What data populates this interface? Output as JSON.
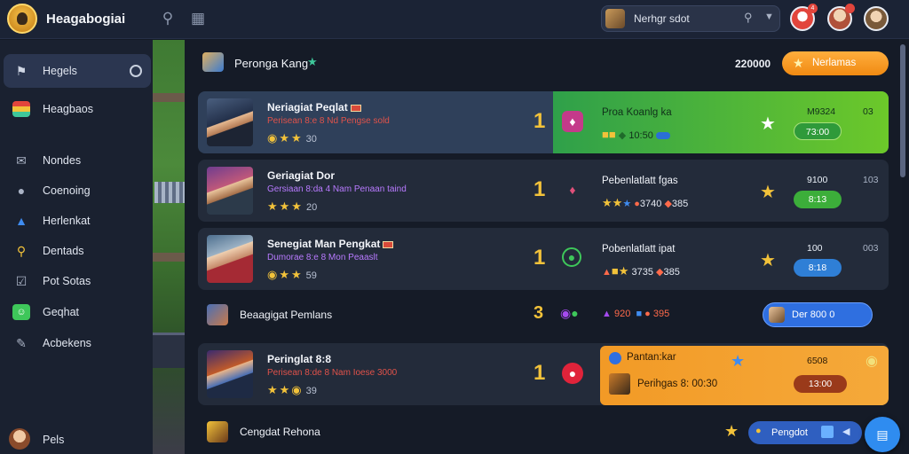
{
  "app": {
    "title": "Heagabogiai"
  },
  "topbar": {
    "search_text": "Nerhgr sdot",
    "notification_badge": "4"
  },
  "sidebar": {
    "items": [
      {
        "label": "Hegels",
        "icon": "flag-icon"
      },
      {
        "label": "Heagbaos",
        "icon": "book-icon"
      },
      {
        "label": "Nondes",
        "icon": "mail-icon"
      },
      {
        "label": "Coenoing",
        "icon": "chat-icon"
      },
      {
        "label": "Herlenkat",
        "icon": "person-icon"
      },
      {
        "label": "Dentads",
        "icon": "key-icon"
      },
      {
        "label": "Pot Sotas",
        "icon": "checkbox-icon"
      },
      {
        "label": "Geqhat",
        "icon": "message-icon"
      },
      {
        "label": "Acbekens",
        "icon": "edit-icon"
      }
    ],
    "user_label": "Pels"
  },
  "header": {
    "title": "Peronga Kang",
    "score": "220000",
    "button_label": "Nerlamas"
  },
  "rows": [
    {
      "name": "Neriagiat Peqlat",
      "sub": "Perisean 8:e 8 Nd Pengse sold",
      "rating": "30",
      "rank": "1",
      "title2": "Proa Koanlg ka",
      "stats": "10:50",
      "val": "M9324",
      "pill": "73:00",
      "val2": "03"
    },
    {
      "name": "Geriagiat Dor",
      "sub": "Gersiaan 8:da 4 Nam Penaan taind",
      "rating": "20",
      "rank": "1",
      "title2": "Pebenlatlatt fgas",
      "stats_a": "3740",
      "stats_b": "385",
      "val": "9100",
      "pill": "8:13",
      "val2": "103"
    },
    {
      "name": "Senegiat Man Pengkat",
      "sub": "Dumorae 8:e 8 Mon Peaaslt",
      "rating": "59",
      "rank": "1",
      "title2": "Pobenlatlatt ipat",
      "stats_a": "3735",
      "stats_b": "385",
      "val": "100",
      "pill": "8:18",
      "val2": "003"
    },
    {
      "label": "Beaagigat Pemlans",
      "rank": "3",
      "stats_a": "920",
      "stats_b": "395",
      "button": "Der  800  0"
    },
    {
      "name": "Peringlat 8:8",
      "sub": "Perisean 8:de 8 Nam Ioese 3000",
      "rating": "39",
      "rank": "1",
      "title2": "Pantan:kar",
      "title3": "Perihgas 8: 00:30",
      "val": "6508",
      "pill": "13:00"
    },
    {
      "label": "Cengdat Rehona",
      "button": "Pengdot"
    }
  ]
}
